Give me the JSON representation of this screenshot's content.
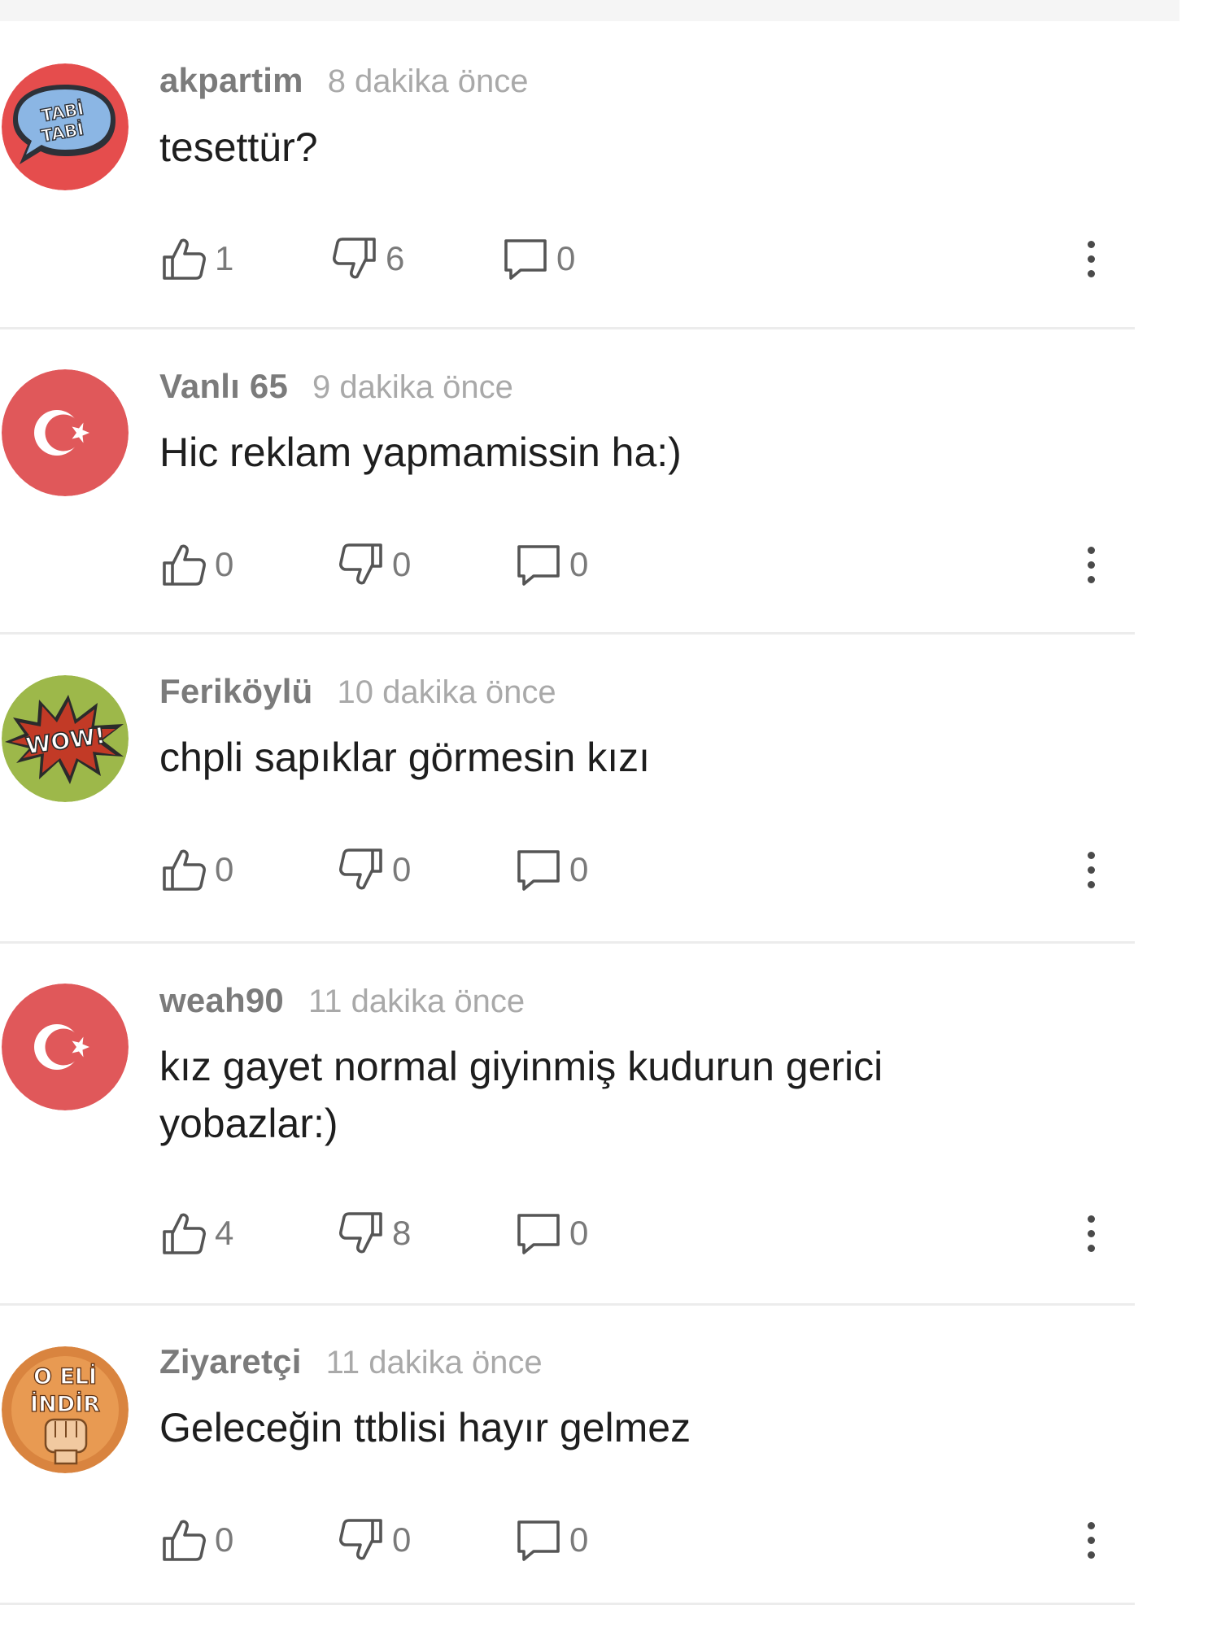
{
  "comments": [
    {
      "username": "akpartim",
      "time": "8 dakika önce",
      "text": "tesettür?",
      "likes": "1",
      "dislikes": "6",
      "replies": "0",
      "avatar": {
        "type": "tabi-speech-bubble",
        "label_line1": "TABİ",
        "label_line2": "TABİ",
        "bg": "#e54d4d"
      }
    },
    {
      "username": "Vanlı 65",
      "time": "9 dakika önce",
      "text": "Hic reklam yapmamissin ha:)",
      "likes": "0",
      "dislikes": "0",
      "replies": "0",
      "avatar": {
        "type": "turkish-flag",
        "bg": "#e0585a"
      }
    },
    {
      "username": "Feriköylü",
      "time": "10 dakika önce",
      "text": "chpli sapıklar görmesin kızı",
      "likes": "0",
      "dislikes": "0",
      "replies": "0",
      "avatar": {
        "type": "wow-burst",
        "label": "WOW!",
        "bg": "#9db84a"
      }
    },
    {
      "username": "weah90",
      "time": "11 dakika önce",
      "text": "kız gayet normal giyinmiş kudurun gerici yobazlar:)",
      "likes": "4",
      "dislikes": "8",
      "replies": "0",
      "avatar": {
        "type": "turkish-flag",
        "bg": "#e0585a"
      }
    },
    {
      "username": "Ziyaretçi",
      "time": "11 dakika önce",
      "text": "Geleceğin ttblisi hayır gelmez",
      "likes": "0",
      "dislikes": "0",
      "replies": "0",
      "avatar": {
        "type": "fist-badge",
        "label_line1": "O ELİ",
        "label_line2": "İNDİR",
        "bg": "#d9843f"
      }
    }
  ]
}
